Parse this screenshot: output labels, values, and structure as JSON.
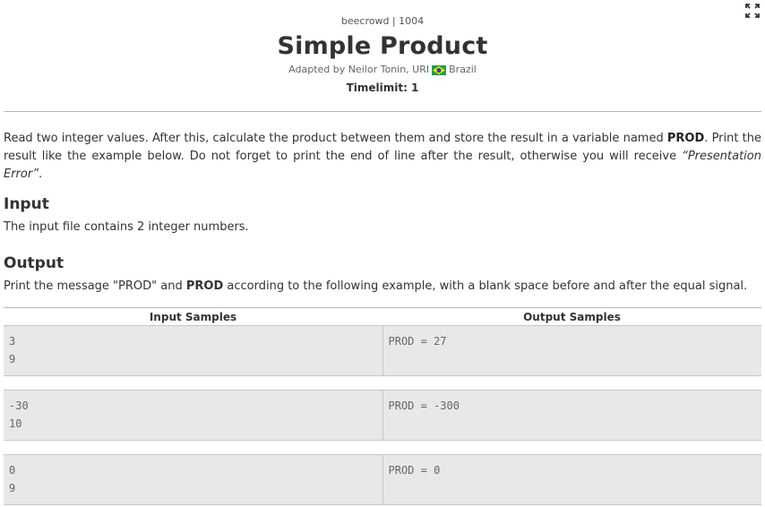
{
  "header": {
    "breadcrumb": "beecrowd | 1004",
    "title": "Simple Product",
    "author_prefix": "Adapted by Neilor Tonin, URI",
    "country": "Brazil",
    "timelimit": "Timelimit: 1"
  },
  "description": {
    "p1_a": "Read two integer values. After this, calculate the product between them and store the result in a variable named ",
    "p1_bold": "PROD",
    "p1_b": ". Print the result like the example below. Do not forget to print the end of line after the result, otherwise you will receive ",
    "p1_italic": "“Presentation Error”",
    "p1_c": "."
  },
  "input_section": {
    "heading": "Input",
    "text": "The input file contains 2 integer numbers."
  },
  "output_section": {
    "heading": "Output",
    "text_a": "Print the message \"PROD\" and ",
    "text_bold": "PROD",
    "text_b": " according to the following example, with a blank space before and after the equal signal."
  },
  "samples": {
    "input_header": "Input Samples",
    "output_header": "Output Samples",
    "rows": [
      {
        "input": [
          "3",
          "9"
        ],
        "output": [
          "PROD = 27"
        ]
      },
      {
        "input": [
          "-30",
          "10"
        ],
        "output": [
          "PROD = -300"
        ]
      },
      {
        "input": [
          "0",
          "9"
        ],
        "output": [
          "PROD = 0"
        ]
      }
    ]
  },
  "icons": {
    "expand": "expand-icon",
    "flag": "brazil-flag-icon"
  },
  "colors": {
    "sample_bg": "#e8e8e8",
    "text": "#333333",
    "divider": "#b8b8b8"
  }
}
